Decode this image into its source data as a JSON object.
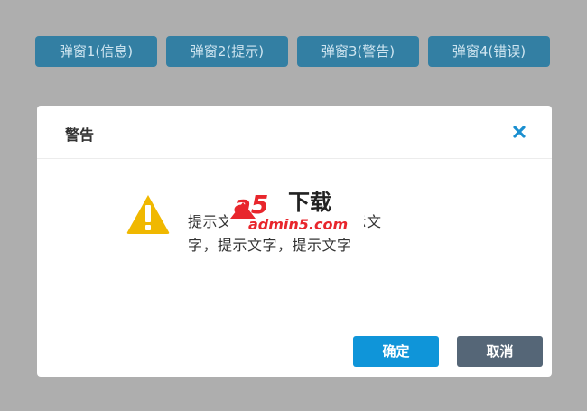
{
  "demo_buttons": [
    {
      "label": "弹窗1(信息)"
    },
    {
      "label": "弹窗2(提示)"
    },
    {
      "label": "弹窗3(警告)"
    },
    {
      "label": "弹窗4(错误)"
    }
  ],
  "dialog": {
    "title": "警告",
    "message_line1": "提示文字，提示文字，提示文",
    "message_line2": "字，提示文字，提示文字",
    "ok_label": "确定",
    "cancel_label": "取消",
    "icons": {
      "close": "close-icon",
      "status": "warning-icon"
    }
  },
  "watermark": {
    "logo_text": "a5",
    "logo_suffix": "下载",
    "url": "admin5.com"
  },
  "colors": {
    "background": "#aeaeae",
    "demo_button": "#337fa3",
    "ok_button": "#0f95d9",
    "cancel_button": "#556677",
    "warning": "#f0b800",
    "close": "#1a8fd0",
    "watermark_red": "#e8262c"
  }
}
